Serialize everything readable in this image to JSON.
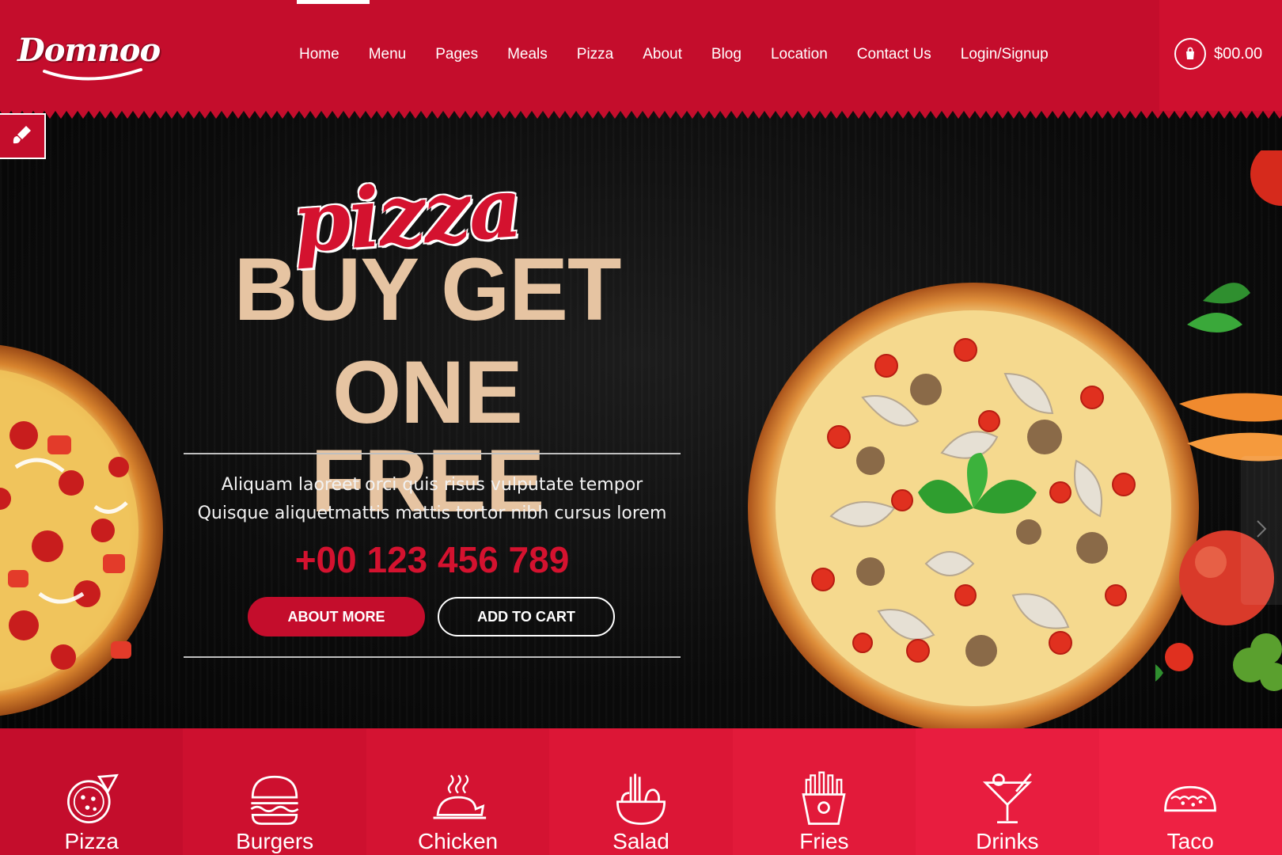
{
  "header": {
    "logo_text": "Domnoo",
    "nav": [
      "Home",
      "Menu",
      "Pages",
      "Meals",
      "Pizza",
      "About",
      "Blog",
      "Location",
      "Contact Us",
      "Login/Signup"
    ],
    "cart_total": "$00.00"
  },
  "hero": {
    "script_title": "pizza",
    "headline_line1": "BUY GET",
    "headline_line2": "ONE FREE",
    "tagline": "Aliquam laoreet orci quis risus vulputate tempor Quisque aliquetmattis mattis tortor nibh cursus lorem",
    "phone": "+00 123 456 789",
    "primary_button": "ABOUT MORE",
    "secondary_button": "ADD TO CART"
  },
  "categories": [
    {
      "label": "Pizza",
      "icon": "pizza-icon",
      "bg": "#c40d2c"
    },
    {
      "label": "Burgers",
      "icon": "burger-icon",
      "bg": "#cd102f"
    },
    {
      "label": "Chicken",
      "icon": "chicken-icon",
      "bg": "#d41332"
    },
    {
      "label": "Salad",
      "icon": "salad-icon",
      "bg": "#dc1636"
    },
    {
      "label": "Fries",
      "icon": "fries-icon",
      "bg": "#e21a3a"
    },
    {
      "label": "Drinks",
      "icon": "drinks-icon",
      "bg": "#e81d3f"
    },
    {
      "label": "Taco",
      "icon": "taco-icon",
      "bg": "#ee2143"
    }
  ],
  "colors": {
    "brand_red": "#c40d2c",
    "headline_beige": "#e6c4a2",
    "phone_red": "#d4122f"
  }
}
